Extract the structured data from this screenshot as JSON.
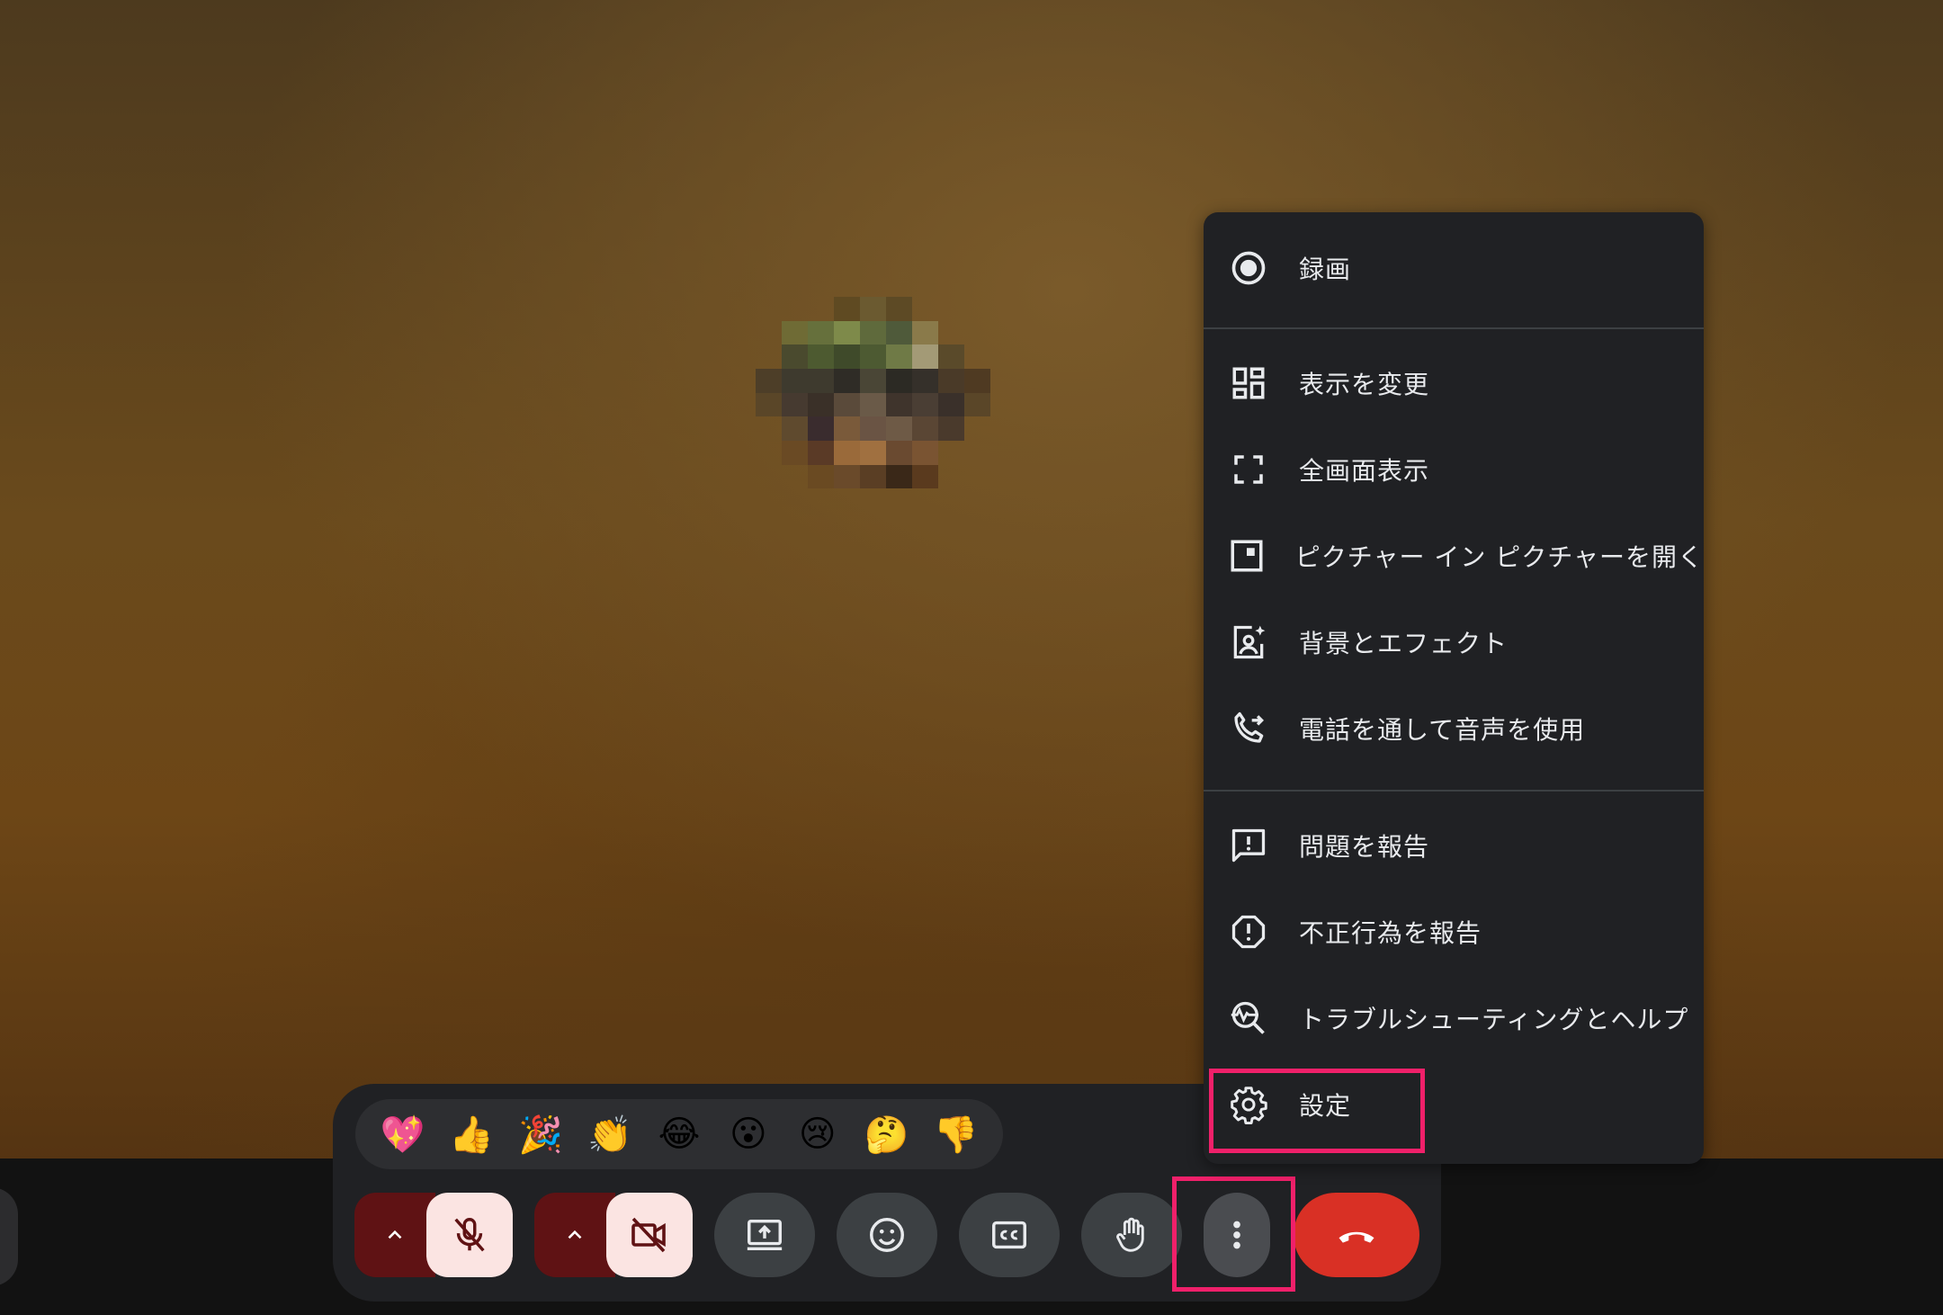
{
  "menu": {
    "items": [
      {
        "label": "録画",
        "icon": "record-icon"
      },
      {
        "label": "表示を変更",
        "icon": "layout-icon"
      },
      {
        "label": "全画面表示",
        "icon": "fullscreen-icon"
      },
      {
        "label": "ピクチャー イン ピクチャーを開く",
        "icon": "picture-in-picture-icon"
      },
      {
        "label": "背景とエフェクト",
        "icon": "background-effects-icon"
      },
      {
        "label": "電話を通して音声を使用",
        "icon": "phone-forward-icon"
      },
      {
        "label": "問題を報告",
        "icon": "feedback-icon"
      },
      {
        "label": "不正行為を報告",
        "icon": "report-abuse-icon"
      },
      {
        "label": "トラブルシューティングとヘルプ",
        "icon": "troubleshoot-icon"
      },
      {
        "label": "設定",
        "icon": "gear-icon"
      }
    ]
  },
  "reactions": [
    "💖",
    "👍",
    "🎉",
    "👏",
    "😂",
    "😮",
    "😢",
    "🤔",
    "👎"
  ],
  "controls": {
    "mic": {
      "state": "muted",
      "icon": "mic-off-icon"
    },
    "camera": {
      "state": "off",
      "icon": "camera-off-icon"
    },
    "present": {
      "icon": "present-screen-icon"
    },
    "emoji": {
      "icon": "emoji-icon"
    },
    "captions": {
      "icon": "captions-icon"
    },
    "raise_hand": {
      "icon": "raise-hand-icon"
    },
    "more": {
      "icon": "more-vert-icon"
    },
    "hangup": {
      "icon": "hangup-icon"
    }
  },
  "colors": {
    "menu_bg": "#202124",
    "highlight": "#f0206a",
    "hangup": "#d93025",
    "muted_bg": "#fbe4e2",
    "muted_caret": "#5f1214"
  }
}
